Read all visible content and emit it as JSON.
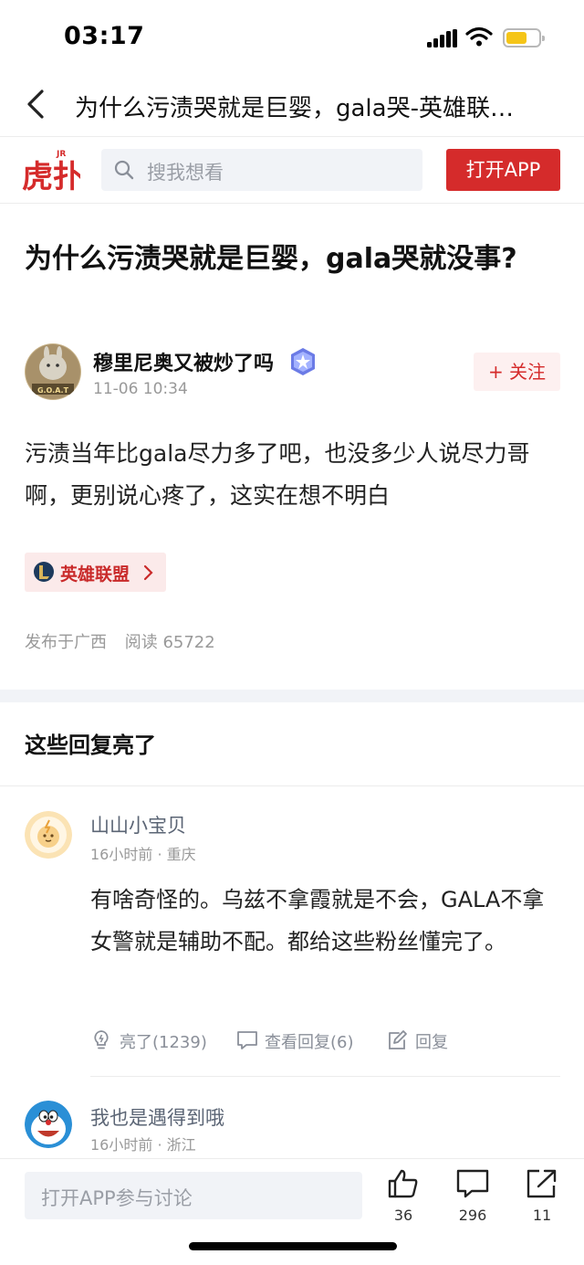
{
  "status_bar": {
    "time": "03:17"
  },
  "nav": {
    "title": "为什么污渍哭就是巨婴，gala哭-英雄联…"
  },
  "header": {
    "logo_text": "虎扑",
    "logo_badge": "JR",
    "search_placeholder": "搜我想看",
    "open_app_label": "打开APP"
  },
  "post": {
    "title": "为什么污渍哭就是巨婴，gala哭就没事?",
    "author": "穆里尼奥又被炒了吗",
    "avatar_caption": "G.O.A.T",
    "time": "11-06 10:34",
    "follow_label": "+ 关注",
    "body": "污渍当年比gala尽力多了吧，也没多少人说尽力哥啊，更别说心疼了，这实在想不明白",
    "tag": "英雄联盟",
    "location": "发布于广西",
    "reads": "阅读 65722"
  },
  "section": {
    "title": "这些回复亮了"
  },
  "comments": [
    {
      "user": "山山小宝贝",
      "meta": "16小时前 · 重庆",
      "text": "有啥奇怪的。乌兹不拿霞就是不会，GALA不拿女警就是辅助不配。都给这些粉丝懂完了。",
      "like_label": "亮了(1239)",
      "view_replies_label": "查看回复(6)",
      "reply_label": "回复"
    },
    {
      "user": "我也是遇得到哦",
      "meta": "16小时前 · 浙江"
    }
  ],
  "bottom_bar": {
    "placeholder": "打开APP参与讨论",
    "likes": "36",
    "comments": "296",
    "shares": "11"
  },
  "colors": {
    "accent": "#d52b2b",
    "background": "#ffffff",
    "muted": "#999999"
  }
}
